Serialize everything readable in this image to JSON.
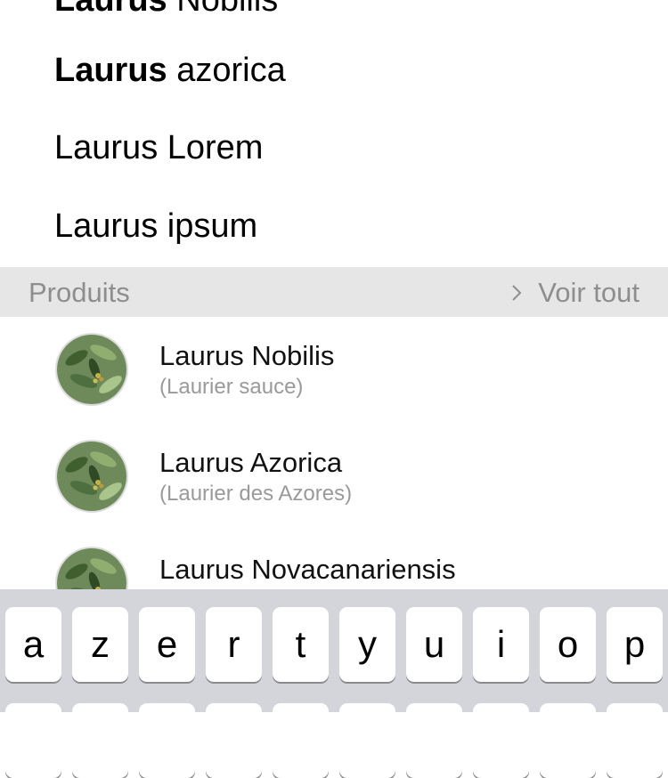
{
  "suggestions": [
    {
      "bold": "Laurus",
      "rest": " Nobilis"
    },
    {
      "bold": "Laurus",
      "rest": " azorica"
    },
    {
      "bold": "",
      "rest": "Laurus Lorem"
    },
    {
      "bold": "",
      "rest": "Laurus ipsum"
    }
  ],
  "products_section": {
    "title": "Produits",
    "see_all_label": "Voir tout",
    "see_all_icon": "chevron-right-icon"
  },
  "products": [
    {
      "name": "Laurus Nobilis",
      "subtitle": "(Laurier sauce)"
    },
    {
      "name": "Laurus Azorica",
      "subtitle": "(Laurier des Azores)"
    },
    {
      "name": "Laurus Novacanariensis",
      "subtitle": ""
    }
  ],
  "keyboard": {
    "row1": [
      "a",
      "z",
      "e",
      "r",
      "t",
      "y",
      "u",
      "i",
      "o",
      "p"
    ]
  },
  "colors": {
    "section_bg": "#e6e6e6",
    "muted_text": "#8e8e8e",
    "keyboard_bg": "#d3d5db"
  }
}
